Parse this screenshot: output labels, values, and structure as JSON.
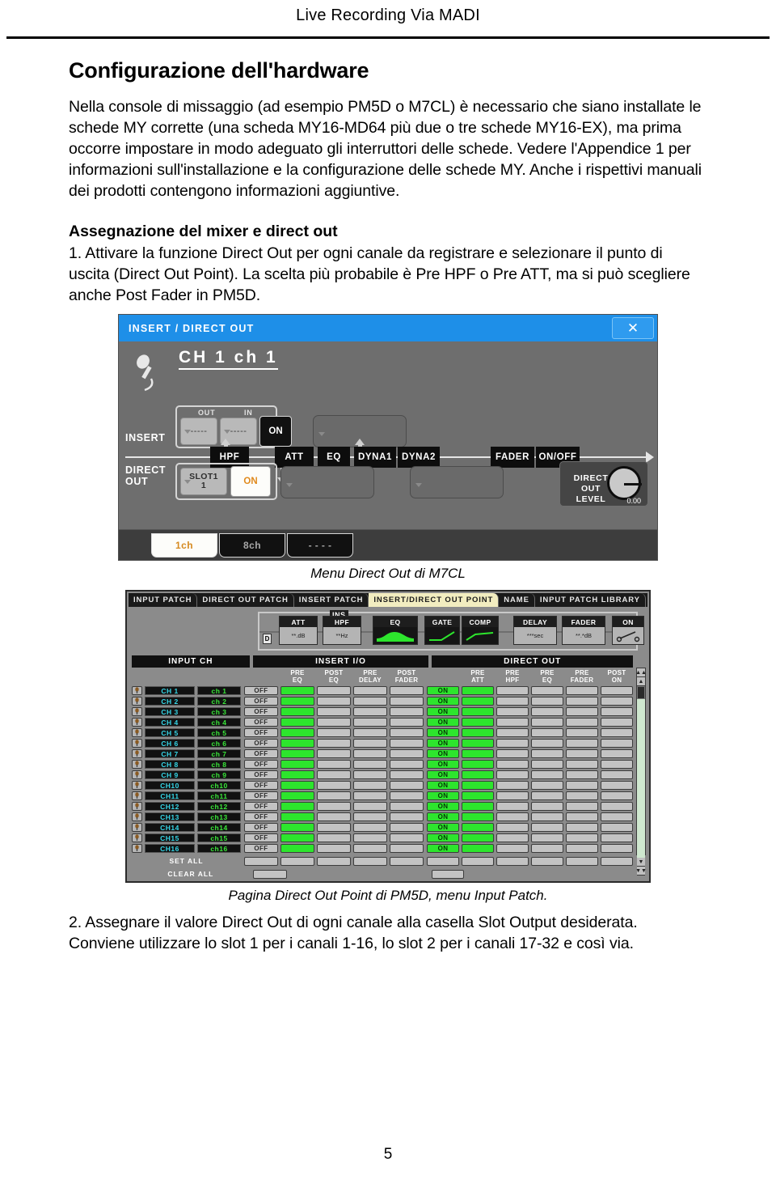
{
  "header": {
    "running_head": "Live Recording Via MADI"
  },
  "page": {
    "number": "5"
  },
  "doc": {
    "title": "Configurazione dell'hardware",
    "intro": "Nella console di missaggio (ad esempio PM5D o M7CL) è necessario che siano installate le schede MY corrette (una scheda MY16-MD64 più due o tre schede MY16-EX), ma prima occorre impostare in modo adeguato gli interruttori delle schede. Vedere l'Appendice 1 per informazioni sull'installazione e la configurazione delle schede MY. Anche i rispettivi manuali dei prodotti contengono informazioni aggiuntive.",
    "section_heading": "Assegnazione del mixer e direct out",
    "step1": "1. Attivare la funzione Direct Out per ogni canale da registrare e selezionare il punto di uscita (Direct Out Point). La scelta più probabile è Pre HPF o Pre ATT, ma si può scegliere anche Post Fader in PM5D.",
    "step2": "2. Assegnare il valore Direct Out di ogni canale alla casella Slot Output desiderata. Conviene utilizzare lo slot 1 per i canali 1-16, lo slot 2 per i canali 17-32 e così via.",
    "caption_m7cl": "Menu Direct Out di M7CL",
    "caption_pm5d": "Pagina Direct Out Point di PM5D, menu Input Patch."
  },
  "m7cl": {
    "title": "INSERT / DIRECT OUT",
    "close_label": "✕",
    "channel": "CH 1   ch 1",
    "insert_label": "INSERT",
    "direct_label": "DIRECT\nOUT",
    "direct_label_line1": "DIRECT",
    "direct_label_line2": "OUT",
    "insert_out_cap": "OUT",
    "insert_in_cap": "IN",
    "insert_out_value": "-----",
    "insert_in_value": "-----",
    "insert_on_label": "ON",
    "direct_slot_line1": "SLOT1",
    "direct_slot_line2": "1",
    "direct_on_label": "ON",
    "level_label_line1": "DIRECT  OUT",
    "level_label_line2": "LEVEL",
    "level_value": "0.00",
    "chain": [
      "HPF",
      "ATT",
      "EQ",
      "DYNA1",
      "DYNA2",
      "FADER",
      "ON/OFF"
    ],
    "footer_tabs": [
      {
        "label": "1ch",
        "selected": true
      },
      {
        "label": "8ch",
        "selected": false
      },
      {
        "label": "- - - -",
        "selected": false
      }
    ]
  },
  "pm5d": {
    "tabs": [
      {
        "label": "INPUT PATCH",
        "selected": false
      },
      {
        "label": "DIRECT OUT PATCH",
        "selected": false
      },
      {
        "label": "INSERT PATCH",
        "selected": false
      },
      {
        "label": "INSERT/DIRECT OUT POINT",
        "selected": true
      },
      {
        "label": "NAME",
        "selected": false
      },
      {
        "label": "INPUT PATCH LIBRARY",
        "selected": false
      }
    ],
    "chain_blocks": [
      {
        "title": "ATT",
        "value": "**.dB"
      },
      {
        "title": "HPF",
        "value": "**Hz"
      },
      {
        "title": "EQ",
        "value": ""
      },
      {
        "title": "GATE",
        "value": ""
      },
      {
        "title": "COMP",
        "value": ""
      },
      {
        "title": "DELAY",
        "value": "***sec"
      },
      {
        "title": "FADER",
        "value": "**.*dB"
      },
      {
        "title": "ON",
        "value": ""
      }
    ],
    "ins_tag": "INS",
    "d_tag": "D",
    "group_headers": {
      "input_ch": "INPUT CH",
      "insert_io": "INSERT I/O",
      "direct_out": "DIRECT OUT"
    },
    "insert_cols": [
      {
        "l1": "",
        "l2": ""
      },
      {
        "l1": "PRE",
        "l2": "EQ"
      },
      {
        "l1": "POST",
        "l2": "EQ"
      },
      {
        "l1": "PRE",
        "l2": "DELAY"
      },
      {
        "l1": "POST",
        "l2": "FADER"
      }
    ],
    "direct_cols": [
      {
        "l1": "",
        "l2": ""
      },
      {
        "l1": "PRE",
        "l2": "ATT"
      },
      {
        "l1": "PRE",
        "l2": "HPF"
      },
      {
        "l1": "PRE",
        "l2": "EQ"
      },
      {
        "l1": "PRE",
        "l2": "FADER"
      },
      {
        "l1": "POST",
        "l2": "ON"
      }
    ],
    "rows": [
      {
        "ch": "CH 1",
        "name": "ch 1",
        "insert_onoff": "OFF",
        "insert": [
          "green",
          "gray",
          "gray",
          "gray"
        ],
        "direct_onoff": "ON",
        "direct": [
          "green",
          "gray",
          "gray",
          "gray",
          "gray"
        ]
      },
      {
        "ch": "CH 2",
        "name": "ch 2",
        "insert_onoff": "OFF",
        "insert": [
          "green",
          "gray",
          "gray",
          "gray"
        ],
        "direct_onoff": "ON",
        "direct": [
          "green",
          "gray",
          "gray",
          "gray",
          "gray"
        ]
      },
      {
        "ch": "CH 3",
        "name": "ch 3",
        "insert_onoff": "OFF",
        "insert": [
          "green",
          "gray",
          "gray",
          "gray"
        ],
        "direct_onoff": "ON",
        "direct": [
          "green",
          "gray",
          "gray",
          "gray",
          "gray"
        ]
      },
      {
        "ch": "CH 4",
        "name": "ch 4",
        "insert_onoff": "OFF",
        "insert": [
          "green",
          "gray",
          "gray",
          "gray"
        ],
        "direct_onoff": "ON",
        "direct": [
          "green",
          "gray",
          "gray",
          "gray",
          "gray"
        ]
      },
      {
        "ch": "CH 5",
        "name": "ch 5",
        "insert_onoff": "OFF",
        "insert": [
          "green",
          "gray",
          "gray",
          "gray"
        ],
        "direct_onoff": "ON",
        "direct": [
          "green",
          "gray",
          "gray",
          "gray",
          "gray"
        ]
      },
      {
        "ch": "CH 6",
        "name": "ch 6",
        "insert_onoff": "OFF",
        "insert": [
          "green",
          "gray",
          "gray",
          "gray"
        ],
        "direct_onoff": "ON",
        "direct": [
          "green",
          "gray",
          "gray",
          "gray",
          "gray"
        ]
      },
      {
        "ch": "CH 7",
        "name": "ch 7",
        "insert_onoff": "OFF",
        "insert": [
          "green",
          "gray",
          "gray",
          "gray"
        ],
        "direct_onoff": "ON",
        "direct": [
          "green",
          "gray",
          "gray",
          "gray",
          "gray"
        ]
      },
      {
        "ch": "CH 8",
        "name": "ch 8",
        "insert_onoff": "OFF",
        "insert": [
          "green",
          "gray",
          "gray",
          "gray"
        ],
        "direct_onoff": "ON",
        "direct": [
          "green",
          "gray",
          "gray",
          "gray",
          "gray"
        ]
      },
      {
        "ch": "CH 9",
        "name": "ch 9",
        "insert_onoff": "OFF",
        "insert": [
          "green",
          "gray",
          "gray",
          "gray"
        ],
        "direct_onoff": "ON",
        "direct": [
          "green",
          "gray",
          "gray",
          "gray",
          "gray"
        ]
      },
      {
        "ch": "CH10",
        "name": "ch10",
        "insert_onoff": "OFF",
        "insert": [
          "green",
          "gray",
          "gray",
          "gray"
        ],
        "direct_onoff": "ON",
        "direct": [
          "green",
          "gray",
          "gray",
          "gray",
          "gray"
        ]
      },
      {
        "ch": "CH11",
        "name": "ch11",
        "insert_onoff": "OFF",
        "insert": [
          "green",
          "gray",
          "gray",
          "gray"
        ],
        "direct_onoff": "ON",
        "direct": [
          "green",
          "gray",
          "gray",
          "gray",
          "gray"
        ]
      },
      {
        "ch": "CH12",
        "name": "ch12",
        "insert_onoff": "OFF",
        "insert": [
          "green",
          "gray",
          "gray",
          "gray"
        ],
        "direct_onoff": "ON",
        "direct": [
          "green",
          "gray",
          "gray",
          "gray",
          "gray"
        ]
      },
      {
        "ch": "CH13",
        "name": "ch13",
        "insert_onoff": "OFF",
        "insert": [
          "green",
          "gray",
          "gray",
          "gray"
        ],
        "direct_onoff": "ON",
        "direct": [
          "green",
          "gray",
          "gray",
          "gray",
          "gray"
        ]
      },
      {
        "ch": "CH14",
        "name": "ch14",
        "insert_onoff": "OFF",
        "insert": [
          "green",
          "gray",
          "gray",
          "gray"
        ],
        "direct_onoff": "ON",
        "direct": [
          "green",
          "gray",
          "gray",
          "gray",
          "gray"
        ]
      },
      {
        "ch": "CH15",
        "name": "ch15",
        "insert_onoff": "OFF",
        "insert": [
          "green",
          "gray",
          "gray",
          "gray"
        ],
        "direct_onoff": "ON",
        "direct": [
          "green",
          "gray",
          "gray",
          "gray",
          "gray"
        ]
      },
      {
        "ch": "CH16",
        "name": "ch16",
        "insert_onoff": "OFF",
        "insert": [
          "green",
          "gray",
          "gray",
          "gray"
        ],
        "direct_onoff": "ON",
        "direct": [
          "green",
          "gray",
          "gray",
          "gray",
          "gray"
        ]
      }
    ],
    "set_all_label": "SET ALL",
    "clear_all_label": "CLEAR ALL"
  },
  "colors": {
    "title_blue": "#1e8fe8",
    "cell_green": "#2de52d",
    "tab_yellow": "#f2edc0",
    "accent_orange": "#d68a20",
    "ch_cyan": "#36d7e8",
    "ch_green": "#3ae83a"
  }
}
